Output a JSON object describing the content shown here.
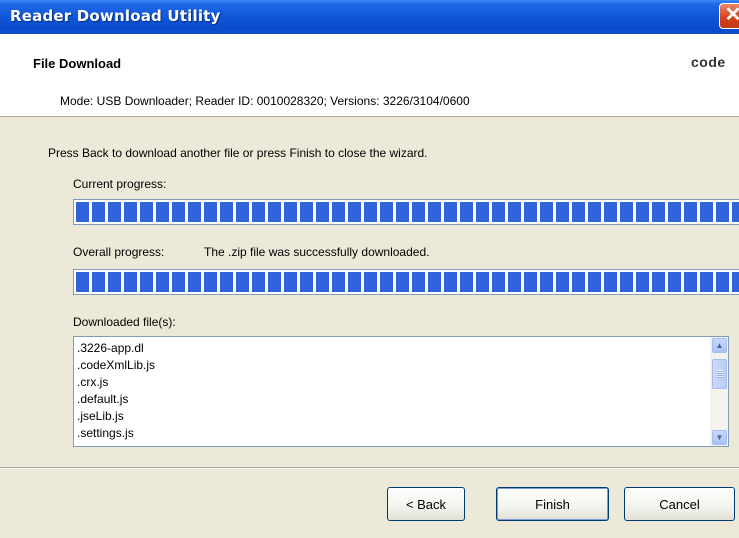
{
  "window": {
    "title": "Reader Download Utility",
    "close_glyph": "✕"
  },
  "header": {
    "title": "File Download",
    "brand": "code",
    "mode_line": "Mode: USB Downloader; Reader ID: 0010028320; Versions: 3226/3104/0600"
  },
  "body": {
    "instruction": "Press Back to download another file or press Finish to close the wizard.",
    "current_progress": {
      "label": "Current progress:",
      "value_fraction": 1.0
    },
    "overall_progress": {
      "label": "Overall progress:",
      "status": "The .zip file was successfully downloaded.",
      "value_fraction": 1.0
    },
    "downloaded_files": {
      "label": "Downloaded file(s):",
      "items": [
        ".3226-app.dl",
        ".codeXmlLib.js",
        ".crx.js",
        ".default.js",
        ".jseLib.js",
        ".settings.js"
      ]
    }
  },
  "buttons": {
    "back": "< Back",
    "finish": "Finish",
    "cancel": "Cancel"
  },
  "colors": {
    "title_bar": "#0a4bcc",
    "progress_fill": "#2f62dc",
    "dialog_bg": "#ECE9D8",
    "close_button": "#d1401a"
  },
  "icons": {
    "close": "close-icon",
    "scroll_up": "chevron-up-icon",
    "scroll_down": "chevron-down-icon"
  }
}
